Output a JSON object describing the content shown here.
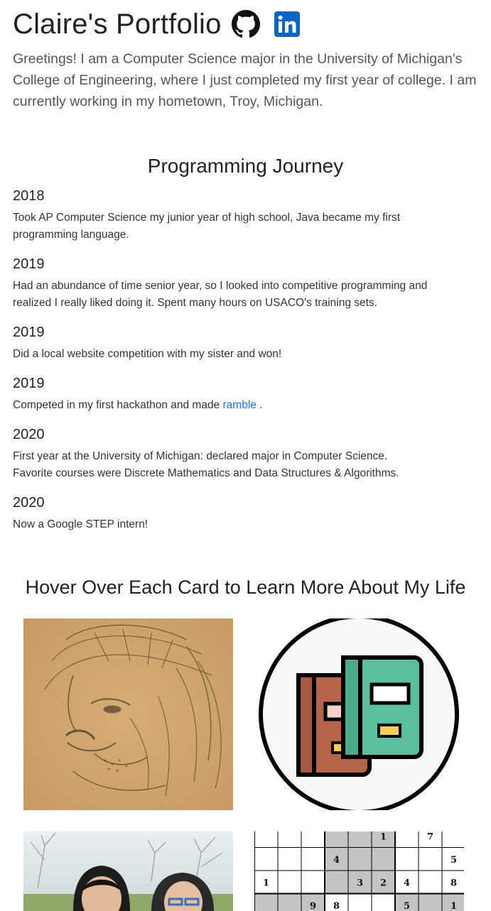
{
  "header": {
    "title": "Claire's Portfolio",
    "github_icon": "github-icon",
    "linkedin_icon": "linkedin-icon",
    "linkedin_label": "in"
  },
  "intro": "Greetings! I am a Computer Science major in the University of Michigan's College of Engineering, where I just completed my first year of college. I am currently working in my hometown, Troy, Michigan.",
  "journey": {
    "title": "Programming Journey",
    "entries": [
      {
        "year": "2018",
        "lines": [
          "Took AP Computer Science my junior year of high school, Java became my first",
          "programming language."
        ]
      },
      {
        "year": "2019",
        "lines": [
          "Had an abundance of time senior year, so I looked into competitive programming and",
          "realized I really liked doing it. Spent many hours on USACO's training sets."
        ]
      },
      {
        "year": "2019",
        "lines": [
          "Did a local website competition with my sister and won!"
        ]
      },
      {
        "year": "2019",
        "text_before": "Competed in my first hackathon and made ",
        "link": "ramble",
        "text_after": " ."
      },
      {
        "year": "2020",
        "lines": [
          "First year at the University of Michigan: declared major in Computer Science.",
          "Favorite courses were Discrete Mathematics and Data Structures & Algorithms."
        ]
      },
      {
        "year": "2020",
        "lines": [
          "Now a Google STEP intern!"
        ]
      }
    ]
  },
  "cards": {
    "title": "Hover Over Each Card to Learn More About My Life",
    "sudoku": [
      "",
      "",
      "",
      "",
      "",
      "1",
      "",
      "7",
      "",
      "",
      "",
      "",
      "4",
      "",
      "",
      "",
      "",
      "5",
      "1",
      "",
      "",
      "",
      "3",
      "2",
      "4",
      "",
      "8",
      "",
      "",
      "9",
      "8",
      "",
      "",
      "5",
      "",
      "1"
    ]
  },
  "colors": {
    "linkedin": "#0a66c2",
    "link": "#1a73e8",
    "book_left": "#b5654a",
    "book_right": "#5bbf9f",
    "lion_bg": "#cfa46e"
  }
}
